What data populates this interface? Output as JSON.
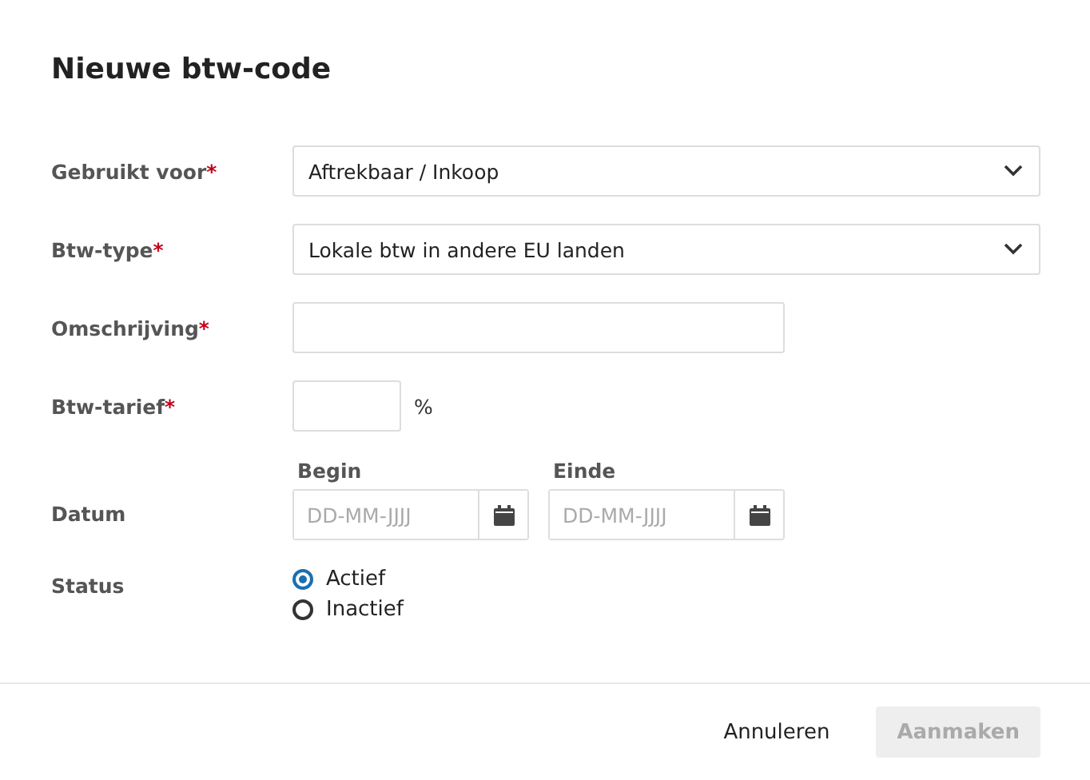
{
  "dialog": {
    "title": "Nieuwe btw-code"
  },
  "fields": [
    {
      "kind": "select",
      "label": "Gebruikt voor",
      "required_mark": "*",
      "value": "Aftrekbaar / Inkoop"
    },
    {
      "kind": "select",
      "label": "Btw-type",
      "required_mark": "*",
      "value": "Lokale btw in andere EU landen"
    },
    {
      "kind": "text",
      "label": "Omschrijving",
      "required_mark": "*"
    },
    {
      "kind": "percent",
      "label": "Btw-tarief",
      "required_mark": "*",
      "unit": "%"
    },
    {
      "kind": "daterange",
      "label": "Datum",
      "dates": [
        {
          "label": "Begin",
          "placeholder": "DD-MM-JJJJ"
        },
        {
          "label": "Einde",
          "placeholder": "DD-MM-JJJJ"
        }
      ]
    },
    {
      "kind": "radio",
      "label": "Status",
      "options": [
        {
          "label": "Actief",
          "selected": true
        },
        {
          "label": "Inactief",
          "selected": false
        }
      ]
    }
  ],
  "buttons": [
    {
      "label": "Annuleren",
      "kind": "cancel",
      "disabled": false
    },
    {
      "label": "Aanmaken",
      "kind": "primary",
      "disabled": true
    }
  ]
}
